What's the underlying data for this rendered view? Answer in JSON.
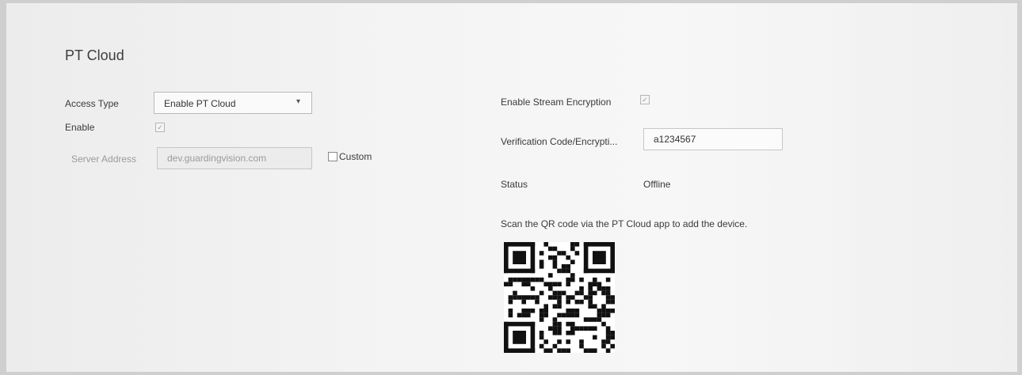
{
  "page": {
    "title": "PT Cloud"
  },
  "left": {
    "access_type": {
      "label": "Access Type",
      "value": "Enable PT Cloud",
      "caret": "▾"
    },
    "enable": {
      "label": "Enable",
      "checked": true
    },
    "server_address": {
      "label": "Server Address",
      "value": "dev.guardingvision.com",
      "custom_label": "Custom",
      "custom_checked": false
    }
  },
  "right": {
    "stream_encryption": {
      "label": "Enable Stream Encryption",
      "checked": true
    },
    "verification_code": {
      "label": "Verification Code/Encrypti...",
      "value": "a1234567"
    },
    "status": {
      "label": "Status",
      "value": "Offline"
    },
    "qr": {
      "hint": "Scan the QR code via the PT Cloud app to add the device."
    }
  },
  "colors": {
    "background": "#f4f4f4",
    "text": "#3a3a3a",
    "disabled_text": "#9a9a9a"
  }
}
